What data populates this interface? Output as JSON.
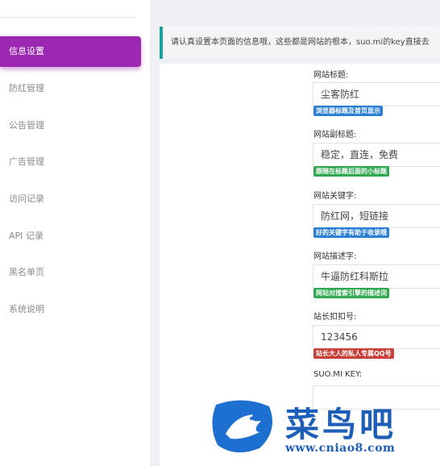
{
  "sidebar": {
    "items": [
      {
        "label": "信息设置",
        "active": true
      },
      {
        "label": "防红管理"
      },
      {
        "label": "公告管理"
      },
      {
        "label": "广告管理"
      },
      {
        "label": "访问记录"
      },
      {
        "label": "API 记录"
      },
      {
        "label": "黑名单页"
      },
      {
        "label": "系统说明"
      }
    ]
  },
  "notice": {
    "text": "请认真设置本页面的信息哦，这些都是网站的根本，suo.mi的key直接去"
  },
  "form": {
    "fields": [
      {
        "label": "网站标题:",
        "value": "尘客防红",
        "hint": "浏览器标题及首页显示",
        "hint_color": "#2a7fd4"
      },
      {
        "label": "网站副标题:",
        "value": "稳定，直连，免费",
        "hint": "跟随在标题后面的小标题",
        "hint_color": "#2fa84f"
      },
      {
        "label": "网站关键字:",
        "value": "防红网，短链接",
        "hint": "好的关键字有助于收录哦",
        "hint_color": "#2a7fd4"
      },
      {
        "label": "网站描述字:",
        "value": "牛逼防红科斯拉",
        "hint": "网站对搜索引擎的描述词",
        "hint_color": "#2fa84f"
      },
      {
        "label": "站长扣扣号:",
        "value": "123456",
        "hint": "站长大人的私人专属QQ号",
        "hint_color": "#c9403a"
      },
      {
        "label": "SUO.MI KEY:",
        "value": ""
      }
    ]
  },
  "watermark": {
    "name": "菜鸟吧",
    "url": "www.cniao8.com",
    "color": "#1d5fb8"
  },
  "colors": {
    "accent": "#9c27b0",
    "notice_border": "#1f9e9e"
  }
}
